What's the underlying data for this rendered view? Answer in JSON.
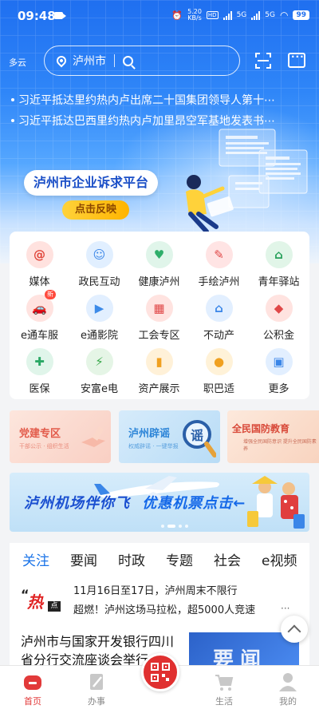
{
  "status_bar": {
    "time": "09:48",
    "net_speed_value": "5.20",
    "net_speed_unit": "KB/s",
    "network_1": "HD",
    "network_2": "5G",
    "network_3": "5G",
    "battery": "99"
  },
  "header": {
    "weather": "多云",
    "city": "泸州市",
    "icons": [
      "location-pin-icon",
      "search-icon",
      "scan-icon",
      "message-icon"
    ]
  },
  "ticker": {
    "items": [
      "习近平抵达里约热内卢出席二十国集团领导人第十⋯",
      "习近平抵达巴西里约热内卢加里昂空军基地发表书⋯"
    ]
  },
  "banner": {
    "title": "泸州市企业诉求平台",
    "button": "点击反映"
  },
  "services": [
    {
      "label": "媒体",
      "icon": "@",
      "color": "#ffe2df",
      "fg": "#e0463b"
    },
    {
      "label": "政民互动",
      "icon": "☺",
      "color": "#e1efff",
      "fg": "#3a86e8"
    },
    {
      "label": "健康泸州",
      "icon": "♥",
      "color": "#e0f5ea",
      "fg": "#2eae6a"
    },
    {
      "label": "手绘泸州",
      "icon": "✎",
      "color": "#ffe4e4",
      "fg": "#e04848"
    },
    {
      "label": "青年驿站",
      "icon": "⌂",
      "color": "#e1f5e8",
      "fg": "#27a05a"
    },
    {
      "label": "e通车服",
      "icon": "🚗",
      "color": "#ffe3e0",
      "fg": "#e04040",
      "badge": "新"
    },
    {
      "label": "e通影院",
      "icon": "▶",
      "color": "#e2efff",
      "fg": "#3c8ae8"
    },
    {
      "label": "工会专区",
      "icon": "▦",
      "color": "#ffe3e0",
      "fg": "#e04848"
    },
    {
      "label": "不动产",
      "icon": "⌂",
      "color": "#e2efff",
      "fg": "#3a86e8"
    },
    {
      "label": "公积金",
      "icon": "◆",
      "color": "#ffe3e0",
      "fg": "#e04848"
    },
    {
      "label": "医保",
      "icon": "✚",
      "color": "#e0f5ea",
      "fg": "#2aa865"
    },
    {
      "label": "安富e电",
      "icon": "⚡",
      "color": "#e5f5e6",
      "fg": "#38a84a"
    },
    {
      "label": "资产展示",
      "icon": "▮",
      "color": "#fff1d8",
      "fg": "#f0a020"
    },
    {
      "label": "职巴适",
      "icon": "●",
      "color": "#fff2d8",
      "fg": "#f0a020"
    },
    {
      "label": "更多",
      "icon": "▣",
      "color": "#e2efff",
      "fg": "#3a86e8"
    }
  ],
  "promo_tiles": [
    {
      "title": "党建专区",
      "sub": "干部公示 · 组织生活"
    },
    {
      "title": "泸州辟谣",
      "sub": "权威辟谣 · 一键举报"
    },
    {
      "title": "全民国防教育",
      "sub": "增强全民国防意识 提升全民国防素养"
    }
  ],
  "air_banner": {
    "text_1": "泸州机场伴你飞",
    "text_2": "优惠机票点击←"
  },
  "news": {
    "tabs": [
      "关注",
      "要闻",
      "时政",
      "专题",
      "社会",
      "e视频"
    ],
    "active_tab": "关注",
    "hot_label": "热点",
    "hot_items": [
      "11月16日至17日，泸州周末不限行",
      "超燃！泸州这场马拉松，超5000人竞速"
    ],
    "more": "···",
    "article_title": "泸州市与国家开发银行四川省分行交流座谈会举行",
    "article_image_text": "要闻"
  },
  "bottom_nav": [
    {
      "label": "首页",
      "icon": "home-icon",
      "active": true
    },
    {
      "label": "办事",
      "icon": "service-icon",
      "active": false
    },
    {
      "label": "",
      "icon": "qr-code-icon",
      "active": false
    },
    {
      "label": "生活",
      "icon": "cart-icon",
      "active": false
    },
    {
      "label": "我的",
      "icon": "profile-icon",
      "active": false
    }
  ],
  "colors": {
    "brand_blue": "#1f6ff0",
    "active_tab": "#1b74e8",
    "nav_active": "#e23a3a",
    "banner_button": "#ffc21a"
  }
}
